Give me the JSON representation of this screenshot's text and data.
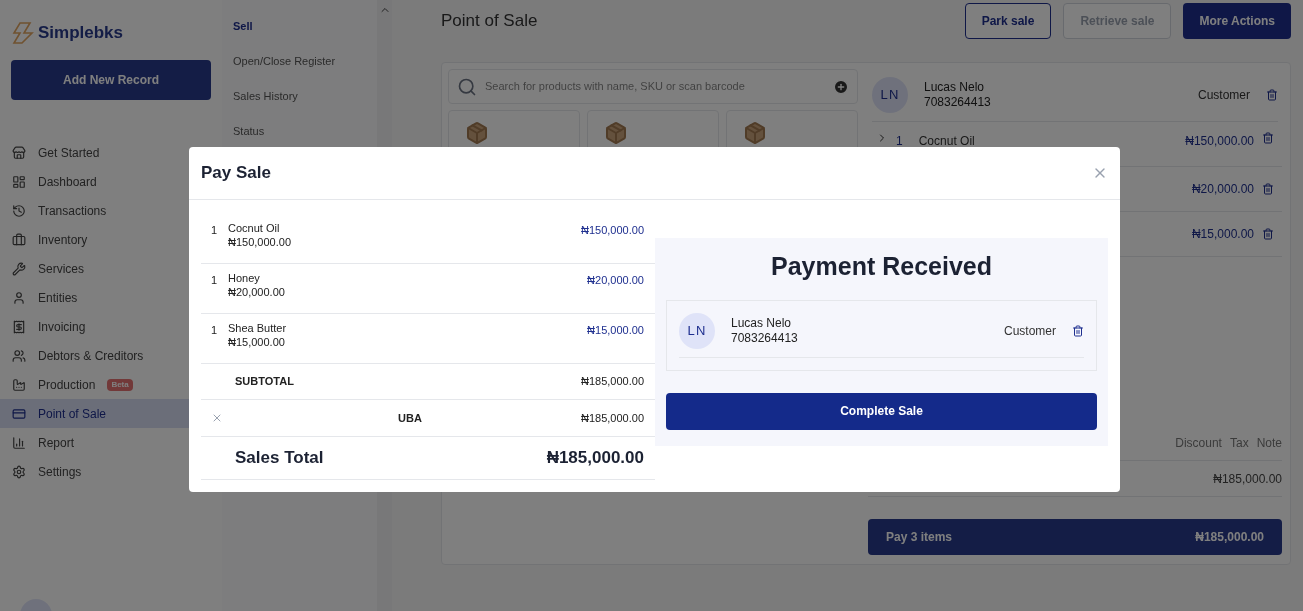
{
  "sidebar": {
    "logo": "Simplebks",
    "add_button": "Add New Record",
    "items": [
      {
        "label": "Get Started",
        "selected": false
      },
      {
        "label": "Dashboard",
        "selected": false
      },
      {
        "label": "Transactions",
        "selected": false
      },
      {
        "label": "Inventory",
        "selected": false
      },
      {
        "label": "Services",
        "selected": false
      },
      {
        "label": "Entities",
        "selected": false
      },
      {
        "label": "Invoicing",
        "selected": false
      },
      {
        "label": "Debtors & Creditors",
        "selected": false
      },
      {
        "label": "Production",
        "selected": false,
        "badge": "Beta"
      },
      {
        "label": "Point of Sale",
        "selected": true
      },
      {
        "label": "Report",
        "selected": false
      },
      {
        "label": "Settings",
        "selected": false
      }
    ]
  },
  "subnav": {
    "items": [
      {
        "label": "Sell",
        "selected": true
      },
      {
        "label": "Open/Close Register",
        "selected": false
      },
      {
        "label": "Sales History",
        "selected": false
      },
      {
        "label": "Status",
        "selected": false
      }
    ]
  },
  "header": {
    "title": "Point of Sale",
    "buttons": [
      {
        "label": "Park sale",
        "kind": "outline"
      },
      {
        "label": "Retrieve sale",
        "kind": "disabled"
      },
      {
        "label": "More Actions",
        "kind": "primary"
      }
    ]
  },
  "search": {
    "placeholder": "Search for products with name, SKU or scan barcode"
  },
  "cart": {
    "customer": {
      "initials": "LN",
      "name": "Lucas Nelo",
      "phone": "7083264413",
      "role": "Customer"
    },
    "items": [
      {
        "qty": "1",
        "name": "Cocnut Oil",
        "price": "₦150,000.00"
      },
      {
        "price": "₦20,000.00"
      },
      {
        "price": "₦15,000.00"
      }
    ],
    "columns": [
      "Discount",
      "Tax",
      "Note"
    ],
    "total": "₦185,000.00",
    "pay_button": {
      "label": "Pay 3 items",
      "amount": "₦185,000.00"
    }
  },
  "modal": {
    "title": "Pay Sale",
    "items": [
      {
        "qty": "1",
        "name": "Cocnut Oil",
        "unit_price": "₦150,000.00",
        "total": "₦150,000.00"
      },
      {
        "qty": "1",
        "name": "Honey",
        "unit_price": "₦20,000.00",
        "total": "₦20,000.00"
      },
      {
        "qty": "1",
        "name": "Shea Butter",
        "unit_price": "₦15,000.00",
        "total": "₦15,000.00"
      }
    ],
    "subtotal": {
      "label": "SUBTOTAL",
      "amount": "₦185,000.00"
    },
    "payment": {
      "method": "UBA",
      "amount": "₦185,000.00"
    },
    "sales_total": {
      "label": "Sales Total",
      "amount": "₦185,000.00"
    },
    "status": "Payment Received",
    "customer": {
      "initials": "LN",
      "name": "Lucas Nelo",
      "phone": "7083264413",
      "role": "Customer"
    },
    "complete_button": "Complete Sale"
  }
}
